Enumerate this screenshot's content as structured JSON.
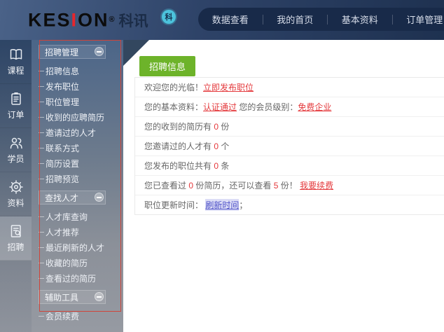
{
  "header": {
    "logo": {
      "brand_pre": "KES",
      "brand_i": "I",
      "brand_post": "ON",
      "reg": "®",
      "cn": "科讯"
    },
    "badge": "科",
    "nav": [
      {
        "label": "数据查看",
        "name": "nav-data-view"
      },
      {
        "label": "我的首页",
        "name": "nav-my-home"
      },
      {
        "label": "基本资料",
        "name": "nav-basic-info"
      },
      {
        "label": "订单管理",
        "name": "nav-order-management"
      }
    ]
  },
  "rail": {
    "items": [
      {
        "label": "课程",
        "icon": "book-icon",
        "name": "rail-item-courses",
        "active": false
      },
      {
        "label": "订单",
        "icon": "clipboard-icon",
        "name": "rail-item-orders",
        "active": false
      },
      {
        "label": "学员",
        "icon": "users-icon",
        "name": "rail-item-students",
        "active": false
      },
      {
        "label": "资料",
        "icon": "gear-icon",
        "name": "rail-item-profile",
        "active": false
      },
      {
        "label": "招聘",
        "icon": "doc-search-icon",
        "name": "rail-item-recruit",
        "active": true
      }
    ]
  },
  "sidemenu": {
    "sections": [
      {
        "title": "招聘管理",
        "name": "menu-section-recruit-management",
        "toggle_icon": "minus-icon",
        "items": [
          {
            "label": "招聘信息",
            "name": "menu-item-recruit-info"
          },
          {
            "label": "发布职位",
            "name": "menu-item-publish-job"
          },
          {
            "label": "职位管理",
            "name": "menu-item-job-management"
          },
          {
            "label": "收到的应聘简历",
            "name": "menu-item-received-resumes"
          },
          {
            "label": "邀请过的人才",
            "name": "menu-item-invited-talents"
          },
          {
            "label": "联系方式",
            "name": "menu-item-contact-info"
          },
          {
            "label": "简历设置",
            "name": "menu-item-resume-settings"
          },
          {
            "label": "招聘预览",
            "name": "menu-item-recruit-preview"
          }
        ]
      },
      {
        "title": "查找人才",
        "name": "menu-section-find-talents",
        "toggle_icon": "minus-icon",
        "items": [
          {
            "label": "人才库查询",
            "name": "menu-item-talent-pool-search"
          },
          {
            "label": "人才推荐",
            "name": "menu-item-talent-recommend"
          },
          {
            "label": "最近刷新的人才",
            "name": "menu-item-recently-refreshed"
          },
          {
            "label": "收藏的简历",
            "name": "menu-item-favorite-resumes"
          },
          {
            "label": "查看过的简历",
            "name": "menu-item-viewed-resumes"
          }
        ]
      },
      {
        "title": "辅助工具",
        "name": "menu-section-auxiliary-tools",
        "toggle_icon": "minus-icon",
        "items": [
          {
            "label": "会员续费",
            "name": "menu-item-member-renewal"
          }
        ]
      }
    ]
  },
  "main": {
    "panel_title": "招聘信息",
    "rows": [
      {
        "segments": [
          {
            "t": "欢迎您的光临！"
          },
          {
            "t": "立即发布职位",
            "style": "red-link",
            "name": "publish-job-now-link"
          }
        ]
      },
      {
        "segments": [
          {
            "t": "您的基本资料："
          },
          {
            "t": "认证通过",
            "style": "red-link",
            "name": "cert-status-link"
          },
          {
            "t": " 您的会员级别："
          },
          {
            "t": "免费企业",
            "style": "red-link",
            "name": "member-level-link"
          }
        ]
      },
      {
        "segments": [
          {
            "t": "您的收到的简历有 "
          },
          {
            "t": "0",
            "style": "red"
          },
          {
            "t": " 份"
          }
        ]
      },
      {
        "segments": [
          {
            "t": "您邀请过的人才有 "
          },
          {
            "t": "0",
            "style": "red"
          },
          {
            "t": " 个"
          }
        ]
      },
      {
        "segments": [
          {
            "t": "您发布的职位共有 "
          },
          {
            "t": "0",
            "style": "red"
          },
          {
            "t": " 条"
          }
        ]
      },
      {
        "segments": [
          {
            "t": "您已查看过 "
          },
          {
            "t": "0",
            "style": "red"
          },
          {
            "t": " 份简历，还可以查看 "
          },
          {
            "t": "5",
            "style": "red"
          },
          {
            "t": " 份！ "
          },
          {
            "t": "我要续费",
            "style": "red-link",
            "name": "renew-membership-link"
          }
        ]
      },
      {
        "segments": [
          {
            "t": "职位更新时间： "
          },
          {
            "t": "刷新时间",
            "style": "blue-link",
            "name": "refresh-time-link"
          },
          {
            "t": "；"
          }
        ]
      }
    ]
  },
  "colors": {
    "header_navy": "#2e4368",
    "nav_pill": "#182a49",
    "accent_green": "#6db32a",
    "alert_red": "#e4393c",
    "link_indigo": "#4f52c8",
    "annotation_red": "#d0453a",
    "badge_cyan": "#4cc3dc"
  }
}
